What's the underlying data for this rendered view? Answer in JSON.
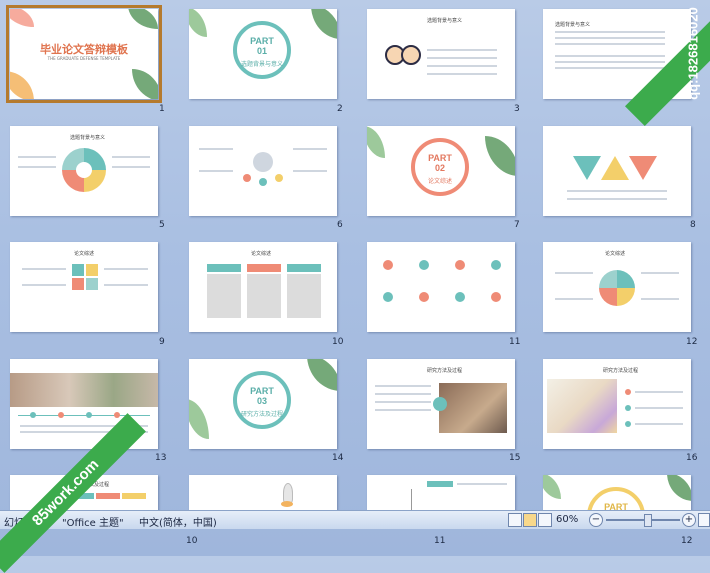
{
  "watermark": {
    "qq_text": "qq:1826816020"
  },
  "banner": {
    "text": "85work.com"
  },
  "slides": [
    {
      "num": "1",
      "title": "毕业论文答辩模板",
      "subtitle": "THE GRADUATE DEFENSE TEMPLATE"
    },
    {
      "num": "2",
      "part": "PART",
      "part_no": "01",
      "label": "选题背景与意义"
    },
    {
      "num": "3",
      "title": "选题背景与意义"
    },
    {
      "num": "4",
      "title": "选题背景与意义"
    },
    {
      "num": "5",
      "title": "选题背景与意义"
    },
    {
      "num": "6"
    },
    {
      "num": "7",
      "part": "PART",
      "part_no": "02",
      "label": "论文综述"
    },
    {
      "num": "8"
    },
    {
      "num": "9",
      "title": "论文综述"
    },
    {
      "num": "10",
      "title": "论文综述"
    },
    {
      "num": "11"
    },
    {
      "num": "12",
      "title": "论文综述"
    },
    {
      "num": "13"
    },
    {
      "num": "14",
      "part": "PART",
      "part_no": "03",
      "label": "研究方法及过程"
    },
    {
      "num": "15",
      "title": "研究方法及过程"
    },
    {
      "num": "16",
      "title": "研究方法及过程"
    },
    {
      "num": "10"
    },
    {
      "num": "11"
    },
    {
      "num": "12",
      "part": "PART"
    }
  ],
  "statusbar": {
    "slide_label": "幻灯片",
    "theme": "\"Office 主题\"",
    "language": "中文(简体，中国)",
    "zoom": "60%",
    "minus": "−",
    "plus": "+"
  },
  "colors": {
    "teal": "#6cc0bb",
    "coral": "#ef8b76",
    "yellow": "#f3cf6a",
    "green": "#3cab4c"
  }
}
